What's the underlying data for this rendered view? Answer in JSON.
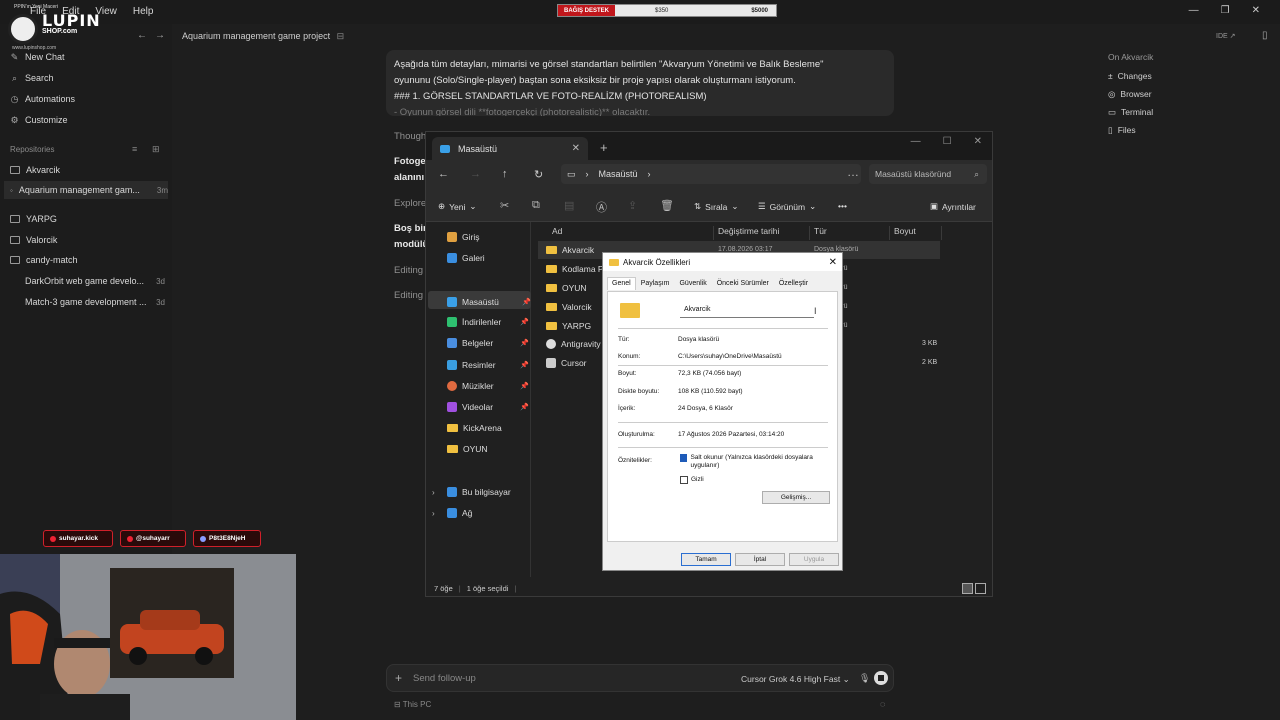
{
  "app": {
    "menu": [
      "File",
      "Edit",
      "View",
      "Help"
    ],
    "window_controls": [
      "—",
      "❐",
      "✕"
    ]
  },
  "overlay": {
    "promo_text": "PPIN'ın Yeni Maceri",
    "logo_text": "LUPIN",
    "logo_sub": "SHOP.com",
    "logo_url": "www.lupinshop.com",
    "donation": {
      "label": "BAĞIŞ DESTEK",
      "current": "$350",
      "goal": "$5000"
    },
    "socials": [
      {
        "label": "suhayar.kick"
      },
      {
        "label": "@suhayarr"
      },
      {
        "label": "P8t3E8NjeH"
      }
    ]
  },
  "sidebar": {
    "nav": [
      {
        "label": "New Chat",
        "icon": "new-chat-icon"
      },
      {
        "label": "Search",
        "icon": "search-icon"
      },
      {
        "label": "Automations",
        "icon": "automations-icon"
      },
      {
        "label": "Customize",
        "icon": "customize-icon"
      }
    ],
    "repositories_label": "Repositories",
    "repos": [
      {
        "label": "Akvarcik",
        "meta": ""
      },
      {
        "label": "Aquarium management gam...",
        "meta": "3m"
      },
      {
        "label": "YARPG",
        "meta": ""
      },
      {
        "label": "Valorcik",
        "meta": ""
      },
      {
        "label": "candy-match",
        "meta": ""
      },
      {
        "label": "DarkOrbit web game develo...",
        "meta": "3d"
      },
      {
        "label": "Match-3 game development ...",
        "meta": "3d"
      }
    ]
  },
  "main": {
    "title": "Aquarium management game project",
    "ide_label": "IDE ↗",
    "message": {
      "line1": "Aşağıda tüm detayları, mimarisi ve görsel standartları belirtilen \"Akvaryum Yönetimi ve Balık Besleme\"",
      "line2": "oyununu (Solo/Single-player) baştan sona eksiksiz bir proje yapısı olarak oluşturmanı istiyorum.",
      "line3": "### 1. GÖRSEL STANDARTLAR VE FOTO-REALİZM (PHOTOREALISM)",
      "line4": "- Oyunun görsel dili **fotogerçekçi (photorealistic)** olacaktır."
    },
    "fragments": {
      "f1": "Though",
      "f2": "Fotoge",
      "f3": "alanını",
      "f4": "Explore",
      "f5": "Boş bir",
      "f6": "modülü",
      "f7": "Editing",
      "f8": "Editing"
    },
    "followup_placeholder": "Send follow-up",
    "model_label": "Cursor Grok 4.6 High Fast",
    "footer_label": "This PC"
  },
  "right_panel": {
    "title": "On Akvarcik",
    "items": [
      {
        "label": "Changes",
        "icon": "changes-icon"
      },
      {
        "label": "Browser",
        "icon": "browser-icon"
      },
      {
        "label": "Terminal",
        "icon": "terminal-icon"
      },
      {
        "label": "Files",
        "icon": "files-icon"
      }
    ]
  },
  "explorer": {
    "tab_title": "Masaüstü",
    "address": "Masaüstü",
    "search_placeholder": "Masaüstü klasöründ",
    "toolbar": {
      "new": "Yeni",
      "sort": "Sırala",
      "view": "Görünüm",
      "details": "Ayrıntılar"
    },
    "nav": [
      {
        "label": "Giriş",
        "pin": false,
        "color": "#e0a040"
      },
      {
        "label": "Galeri",
        "pin": false,
        "color": "#3a8ee0"
      },
      {
        "label": "Masaüstü",
        "pin": true,
        "color": "#3aa0e8"
      },
      {
        "label": "İndirilenler",
        "pin": true,
        "color": "#2ec070"
      },
      {
        "label": "Belgeler",
        "pin": true,
        "color": "#4a8ee0"
      },
      {
        "label": "Resimler",
        "pin": true,
        "color": "#3a9ee0"
      },
      {
        "label": "Müzikler",
        "pin": true,
        "color": "#e06a40"
      },
      {
        "label": "Videolar",
        "pin": true,
        "color": "#a050e0"
      },
      {
        "label": "KickArena",
        "pin": false,
        "color": "#f0c040"
      },
      {
        "label": "OYUN",
        "pin": false,
        "color": "#f0c040"
      },
      {
        "label": "Bu bilgisayar",
        "pin": false,
        "color": "#3a8ee0"
      },
      {
        "label": "Ağ",
        "pin": false,
        "color": "#3a8ee0"
      }
    ],
    "columns": [
      "Ad",
      "Değiştirme tarihi",
      "Tür",
      "Boyut"
    ],
    "rows": [
      {
        "name": "Akvarcik",
        "date": "17.08.2026 03:17",
        "type": "Dosya klasörü",
        "size": ""
      },
      {
        "name": "Kodlama Proj",
        "date": "",
        "type": "asörü",
        "size": ""
      },
      {
        "name": "OYUN",
        "date": "",
        "type": "asörü",
        "size": ""
      },
      {
        "name": "Valorcik",
        "date": "",
        "type": "asörü",
        "size": ""
      },
      {
        "name": "YARPG",
        "date": "",
        "type": "asörü",
        "size": ""
      },
      {
        "name": "Antigravity",
        "date": "",
        "type": "",
        "size": "3 KB"
      },
      {
        "name": "Cursor",
        "date": "",
        "type": "",
        "size": "2 KB"
      }
    ],
    "status_count": "7 öğe",
    "status_selected": "1 öğe seçildi"
  },
  "properties": {
    "title": "Akvarcik Özellikleri",
    "tabs": [
      "Genel",
      "Paylaşım",
      "Güvenlik",
      "Önceki Sürümler",
      "Özelleştir"
    ],
    "name": "Akvarcik",
    "type_k": "Tür:",
    "type_v": "Dosya klasörü",
    "loc_k": "Konum:",
    "loc_v": "C:\\Users\\suhay\\OneDrive\\Masaüstü",
    "size_k": "Boyut:",
    "size_v": "72,3 KB (74.056 bayt)",
    "disk_k": "Diskte boyutu:",
    "disk_v": "108 KB (110.592 bayt)",
    "content_k": "İçerik:",
    "content_v": "24 Dosya, 6 Klasör",
    "created_k": "Oluşturulma:",
    "created_v": "17 Ağustos 2026 Pazartesi, 03:14:20",
    "attr_k": "Öznitelikler:",
    "readonly": "Salt okunur (Yalnızca klasördeki dosyalara uygulanır)",
    "hidden": "Gizli",
    "advanced": "Gelişmiş...",
    "ok": "Tamam",
    "cancel": "İptal",
    "apply": "Uygula"
  }
}
